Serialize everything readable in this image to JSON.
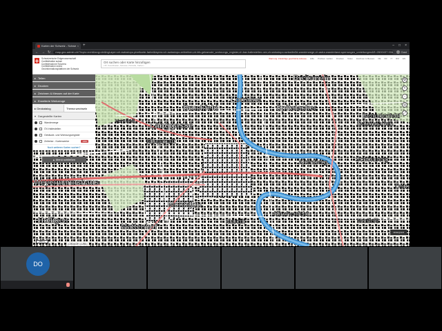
{
  "browser": {
    "tab_title": "Karten der Schweiz - Schweizeri…",
    "tab_close": "×",
    "new_tab": "+",
    "window_controls": [
      "–",
      "□",
      "×"
    ],
    "nav": [
      "←",
      "→",
      "↻"
    ],
    "url": "map.geo.admin.ch/?topic=ech&lang=de&bgLayer=ch.swisstopo.pixelkarte-farbe&layers=ch.swisstopo.zeitreihen,ch.bfs.gebaeude_wohnungs_register,ch.bav.haltestellen-oev,ch.swisstopo.swisstlm3d-wanderwege,ch.astra.wanderland-sperrungen_umleitungen&E=2600437.00&N=1199701.42&zoom=9",
    "user_label": "Gast"
  },
  "header": {
    "logo_lines": [
      "Schweizerische Eidgenossenschaft",
      "Confédération suisse",
      "Confederazione Svizzera",
      "Confederaziun svizra",
      "Geoinformationsplattform der Schweiz"
    ],
    "search_placeholder": "Ort suchen oder Karte hinzufügen",
    "search_hint": "z.B. Koordinaten, Adresse, Parzelle, Karten...",
    "links": [
      "Warnung: Zukünftige geschützte Adresse",
      "Hilfe",
      "Problem melden",
      "Drucken",
      "Teilen",
      "Zeichnen & Messen",
      "DE",
      "FR",
      "IT",
      "RM",
      "EN"
    ]
  },
  "sidebar": {
    "sections": [
      {
        "label": "Teilen"
      },
      {
        "label": "Drucken"
      },
      {
        "label": "Zeichnen & Messen auf der Karte"
      },
      {
        "label": "Erweiterte Werkzeuge"
      }
    ],
    "tabs": [
      "Geokatalog",
      "Thema wechseln"
    ],
    "displayed_header": "Dargestellte Karten",
    "layers": [
      {
        "label": "Wanderwege",
        "kind": "dot"
      },
      {
        "label": "ÖV-Haltestellen",
        "kind": "dot"
      },
      {
        "label": "Gebäude- und Wohnungsregister",
        "kind": "dot"
      },
      {
        "label": "Zeitreise - Kartenwerke",
        "kind": "check",
        "tag": "1952"
      }
    ],
    "more_link": "Noch weiteren Karten suchen?",
    "close_menu": "Menü schließen"
  },
  "map": {
    "labels": [
      "Lorraine",
      "Breitenrain",
      "Spitalacker",
      "Beundenfeld",
      "Baumgarten",
      "Schönberg",
      "Altenberg",
      "Länggasse",
      "Bruckfeld",
      "Muesmatt",
      "Weyermannshaus",
      "Holligen",
      "Mattenhof",
      "Monbijou",
      "Marzili",
      "Kirchenfeld",
      "Ostring",
      "Von Roll",
      "Murifeld"
    ],
    "scale": "200 m",
    "footer": {
      "projection": "CH1903+ / LV95",
      "copyright": "© Daten: swisstopo",
      "links": "Copyright & Datenschutzbestimmungen"
    },
    "chip": "Hintergrund"
  },
  "participants": [
    {
      "initials": "DO"
    },
    {
      "initials": ""
    },
    {
      "initials": ""
    },
    {
      "initials": ""
    },
    {
      "initials": ""
    },
    {
      "initials": ""
    }
  ]
}
